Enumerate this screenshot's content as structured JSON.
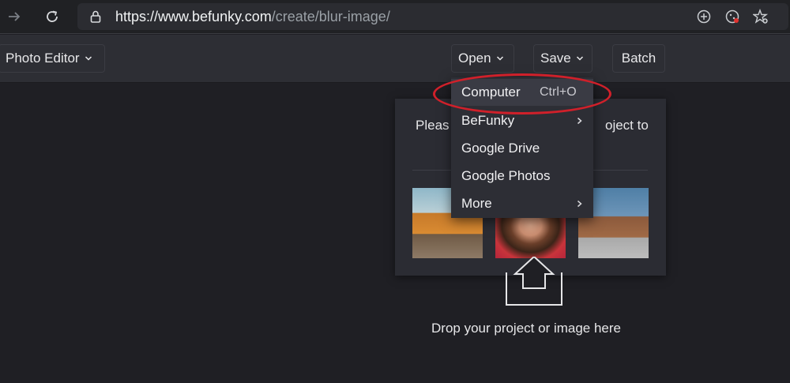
{
  "browser": {
    "url_host": "https://www.befunky.com",
    "url_path": "/create/blur-image/",
    "icons": [
      "forward-icon",
      "reload-icon",
      "lock-icon",
      "add-tab-icon",
      "cookie-icon",
      "favorite-icon"
    ]
  },
  "toolbar": {
    "photo_editor_label": "Photo Editor",
    "open_label": "Open",
    "save_label": "Save",
    "batch_label": "Batch"
  },
  "open_menu": {
    "items": [
      {
        "label": "Computer",
        "shortcut": "Ctrl+O",
        "submenu": false
      },
      {
        "label": "BeFunky",
        "submenu": true
      },
      {
        "label": "Google Drive",
        "submenu": false
      },
      {
        "label": "Google Photos",
        "submenu": false
      },
      {
        "label": "More",
        "submenu": true
      }
    ]
  },
  "panel": {
    "prompt_left": "Pleas",
    "prompt_right": "oject to"
  },
  "drop": {
    "text": "Drop your project or image here"
  },
  "colors": {
    "annotation": "#d0202a",
    "canvas_bg": "#1f1f24",
    "toolbar_bg": "#2d2e34"
  }
}
